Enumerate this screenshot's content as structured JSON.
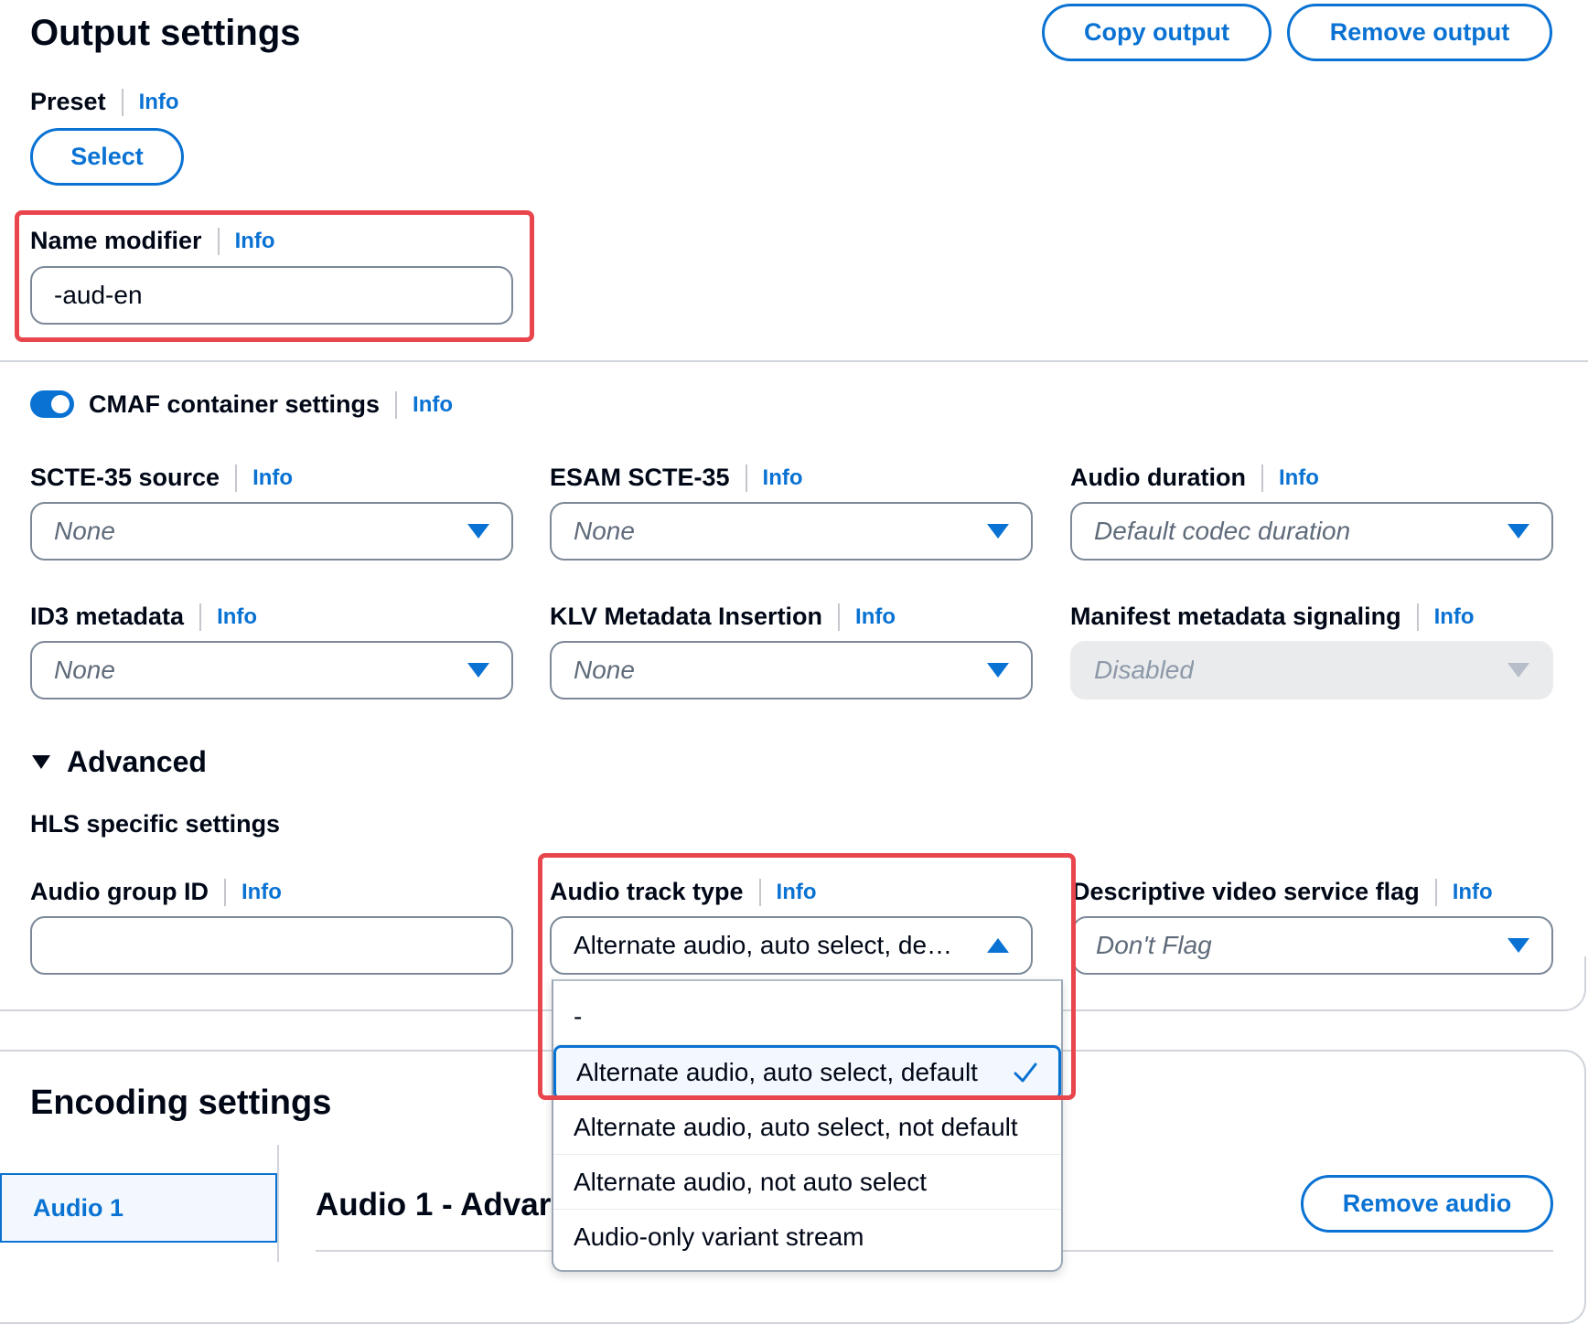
{
  "output_settings": {
    "title": "Output settings",
    "copy_output": "Copy output",
    "remove_output": "Remove output",
    "preset_label": "Preset",
    "select_button": "Select",
    "name_modifier_label": "Name modifier",
    "name_modifier_value": "-aud-en",
    "info": "Info"
  },
  "cmaf": {
    "toggle_label": "CMAF container settings",
    "toggle_on": true,
    "fields": [
      {
        "label": "SCTE-35 source",
        "value": "None"
      },
      {
        "label": "ESAM SCTE-35",
        "value": "None"
      },
      {
        "label": "Audio duration",
        "value": "Default codec duration"
      },
      {
        "label": "ID3 metadata",
        "value": "None"
      },
      {
        "label": "KLV Metadata Insertion",
        "value": "None"
      },
      {
        "label": "Manifest metadata signaling",
        "value": "Disabled"
      }
    ]
  },
  "advanced": {
    "label": "Advanced",
    "hls_title": "HLS specific settings",
    "audio_group_id_label": "Audio group ID",
    "audio_group_id_value": "",
    "audio_track_type_label": "Audio track type",
    "audio_track_type_value": "Alternate audio, auto select, de…",
    "dvs_label": "Descriptive video service flag",
    "dvs_value": "Don't Flag",
    "track_type_options": [
      "-",
      "Alternate audio, auto select, default",
      "Alternate audio, auto select, not default",
      "Alternate audio, not auto select",
      "Audio-only variant stream"
    ],
    "selected_index": 1
  },
  "encoding": {
    "title": "Encoding settings",
    "tab_audio1": "Audio 1",
    "section_title": "Audio 1 - Advar",
    "remove_audio": "Remove audio"
  },
  "colors": {
    "accent": "#0972d3",
    "highlight_box": "#e8464c",
    "text": "#000716"
  }
}
